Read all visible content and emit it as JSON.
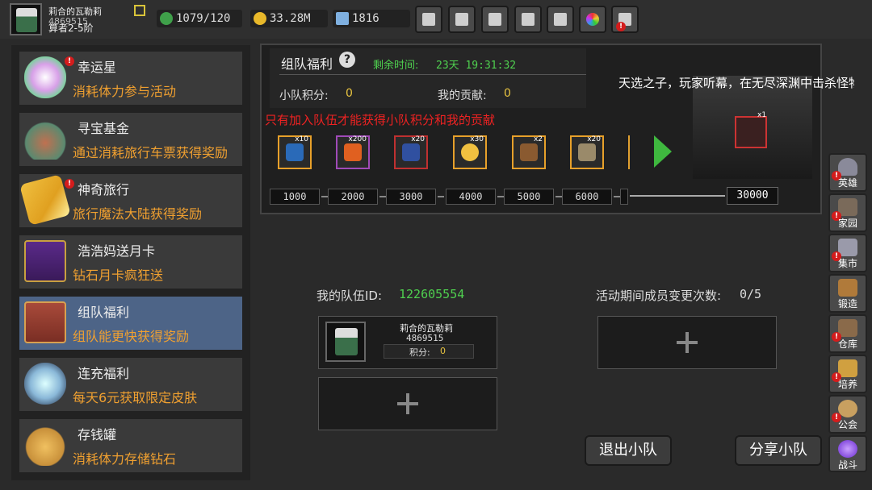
{
  "player": {
    "name": "莉合的瓦勒莉",
    "id": "4869515",
    "title": "算者2-5阶"
  },
  "resources": {
    "stamina": "1079/120",
    "gold": "33.28M",
    "diamonds": "1816"
  },
  "toolbar": {
    "shop_icon": "cart-icon",
    "mail_icon": "mail-icon",
    "gamepad_icon": "gamepad-icon",
    "settings_icon": "gear-icon",
    "gift_icon": "gift-icon",
    "wheel_icon": "wheel-icon",
    "fireworks_icon": "fireworks-icon"
  },
  "sidebar": {
    "items": [
      {
        "title": "幸运星",
        "desc": "消耗体力参与活动",
        "alert": "!"
      },
      {
        "title": "寻宝基金",
        "desc": "通过消耗旅行车票获得奖励"
      },
      {
        "title": "神奇旅行",
        "desc": "旅行魔法大陆获得奖励",
        "alert": "!"
      },
      {
        "title": "浩浩妈送月卡",
        "desc": "钻石月卡疯狂送"
      },
      {
        "title": "组队福利",
        "desc": "组队能更快获得奖励"
      },
      {
        "title": "连充福利",
        "desc": "每天6元获取限定皮肤"
      },
      {
        "title": "存钱罐",
        "desc": "消耗体力存储钻石"
      }
    ]
  },
  "event": {
    "title": "组队福利",
    "help": "?",
    "remaining_label": "剩余时间:",
    "remaining_value": "23天 19:31:32",
    "squad_points_label": "小队积分:",
    "squad_points_value": "0",
    "contribution_label": "我的贡献:",
    "contribution_value": "0",
    "warning": "只有加入队伍才能获得小队积分和我的贡献",
    "rewards": [
      {
        "count": "x10",
        "icon": "lightning-icon"
      },
      {
        "count": "x200",
        "icon": "fire-crystal-icon"
      },
      {
        "count": "x20",
        "icon": "blue-rune-icon"
      },
      {
        "count": "x30",
        "icon": "golden-egg-icon"
      },
      {
        "count": "x2",
        "icon": "cannon-icon"
      },
      {
        "count": "x20",
        "icon": "hammer-icon"
      }
    ],
    "thresholds": [
      "1000",
      "2000",
      "3000",
      "4000",
      "5000",
      "6000"
    ],
    "final_threshold": "30000",
    "final_reward_count": "x1",
    "marquee": "天选之子，玩家听幕，在无尽深渊中击杀怪物"
  },
  "team": {
    "id_label": "我的队伍ID:",
    "id_value": "122605554",
    "changes_label": "活动期间成员变更次数:",
    "changes_value": "0/5",
    "member": {
      "name": "莉合的瓦勒莉",
      "id": "4869515",
      "score_label": "积分:",
      "score_value": "0"
    },
    "leave_button": "退出小队",
    "share_button": "分享小队"
  },
  "rightnav": {
    "items": [
      {
        "label": "英雄",
        "icon": "helmet-icon",
        "alert": "!"
      },
      {
        "label": "家园",
        "icon": "castle-icon",
        "alert": "!"
      },
      {
        "label": "集市",
        "icon": "market-icon",
        "alert": "!"
      },
      {
        "label": "锻造",
        "icon": "anvil-icon"
      },
      {
        "label": "仓库",
        "icon": "storage-icon",
        "alert": "!"
      },
      {
        "label": "培养",
        "icon": "trophy-icon",
        "alert": "!"
      },
      {
        "label": "公会",
        "icon": "guild-icon",
        "alert": "!"
      },
      {
        "label": "战斗",
        "icon": "portal-icon"
      }
    ]
  },
  "colors": {
    "accent_green": "#4fd04f",
    "accent_orange": "#f0a030",
    "alert_red": "#d41c1c",
    "active_tab": "#4d6487"
  }
}
